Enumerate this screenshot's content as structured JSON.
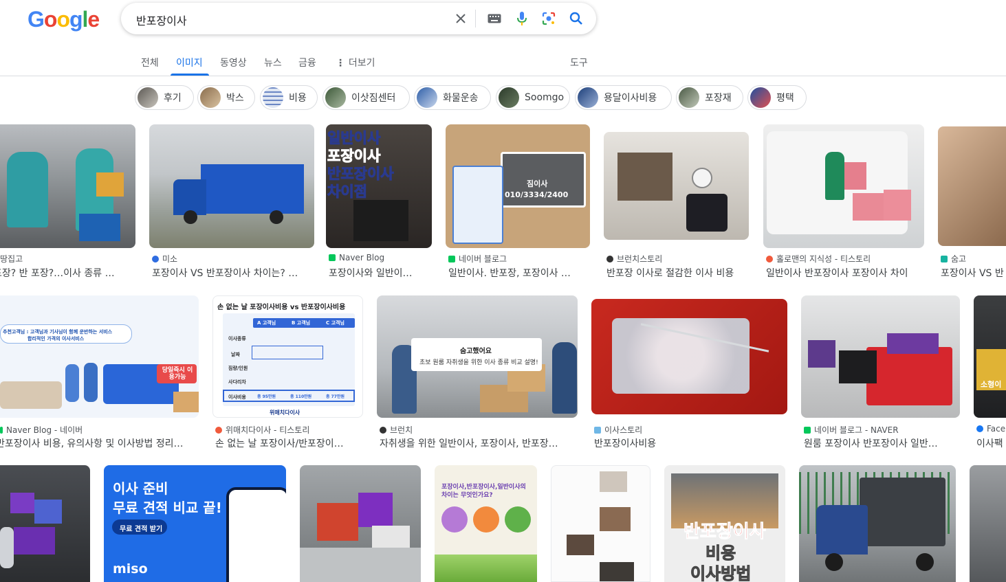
{
  "logo": {
    "letters": [
      "G",
      "o",
      "o",
      "g",
      "l",
      "e"
    ],
    "colors": [
      "#4285f4",
      "#ea4335",
      "#fbbc05",
      "#4285f4",
      "#34a853",
      "#ea4335"
    ]
  },
  "search": {
    "query": "반포장이사"
  },
  "tabs": [
    {
      "label": "전체",
      "active": false
    },
    {
      "label": "이미지",
      "active": true
    },
    {
      "label": "동영상",
      "active": false
    },
    {
      "label": "뉴스",
      "active": false
    },
    {
      "label": "금융",
      "active": false
    },
    {
      "label": "더보기",
      "active": false
    }
  ],
  "tools_label": "도구",
  "chips": [
    "후기",
    "박스",
    "비용",
    "이삿짐센터",
    "화물운송",
    "Soomgo",
    "용달이사비용",
    "포장재",
    "평택"
  ],
  "results": [
    {
      "source": "땅집고",
      "title": "포장? 반 포장?…이사 종류 …"
    },
    {
      "source": "미소",
      "title": "포장이사 VS 반포장이사 차이는? …"
    },
    {
      "source": "Naver Blog",
      "title": "포장이사와 일반이…"
    },
    {
      "source": "네이버 블로그",
      "title": "일반이사. 반포장, 포장이사 …"
    },
    {
      "source": "브런치스토리",
      "title": "반포장 이사로 절감한 이사 비용"
    },
    {
      "source": "홀로맨의 지식성 - 티스토리",
      "title": "일반이사 반포장이사 포장이사 차이"
    },
    {
      "source": "숨고",
      "title": "포장이사 VS 반"
    },
    {
      "source": "Naver Blog - 네이버",
      "title": "반포장이사 비용, 유의사항 및 이사방법 정리…"
    },
    {
      "source": "위매치다이사 - 티스토리",
      "title": "손 없는 날 포장이사/반포장이…"
    },
    {
      "source": "브런치",
      "title": "자취생을 위한 일반이사, 포장이사, 반포장…"
    },
    {
      "source": "이사스토리",
      "title": "반포장이사비용"
    },
    {
      "source": "네이버 블로그 - NAVER",
      "title": "원룸 포장이사 반포장이사 일반…"
    },
    {
      "source": "Face",
      "title": "이사팩"
    }
  ],
  "overlays": {
    "img3": [
      "일반이사",
      "포장이사",
      "반포장이사",
      "차이점"
    ],
    "img4_phone": "010/3334/2400",
    "img4_brand": "짐이사",
    "img9_title": "손 없는 날 포장이사비용 vs 반포장이사비용",
    "img9_cols": [
      "A 고객님",
      "B 고객님",
      "C 고객님"
    ],
    "img9_rows": [
      "이사종류",
      "날짜",
      "짐량/인원",
      "사다리차",
      "이사비용"
    ],
    "img9_costs": [
      "총 95만원",
      "총 110만원",
      "총 77만원"
    ],
    "img9_brand": "위매치다이사",
    "img10_line1": "숨고했어요",
    "img10_line2": "초보 원룸 자취생을 위한 이사 종류 비교 설명!",
    "img8_tag": "추천고객님 : 고객님과 기사님이 함께 운반하는 서비스",
    "img8_tag2": "합리적인 가격의 이사서비스",
    "img8_badge": "당일즉시 이용가능",
    "img_ad_line1": "이사 준비",
    "img_ad_line2": "무료 견적 비교 끝!",
    "img_ad_button": "무료 견적 받기",
    "img_ad_brand": "miso",
    "img_info_title": "포장이사,반포장이사,일반이사의 차이는 무엇인가요?",
    "img_big_text": [
      "반포장이사",
      "비용",
      "이사방법"
    ],
    "img_truck_label": "소형이"
  }
}
